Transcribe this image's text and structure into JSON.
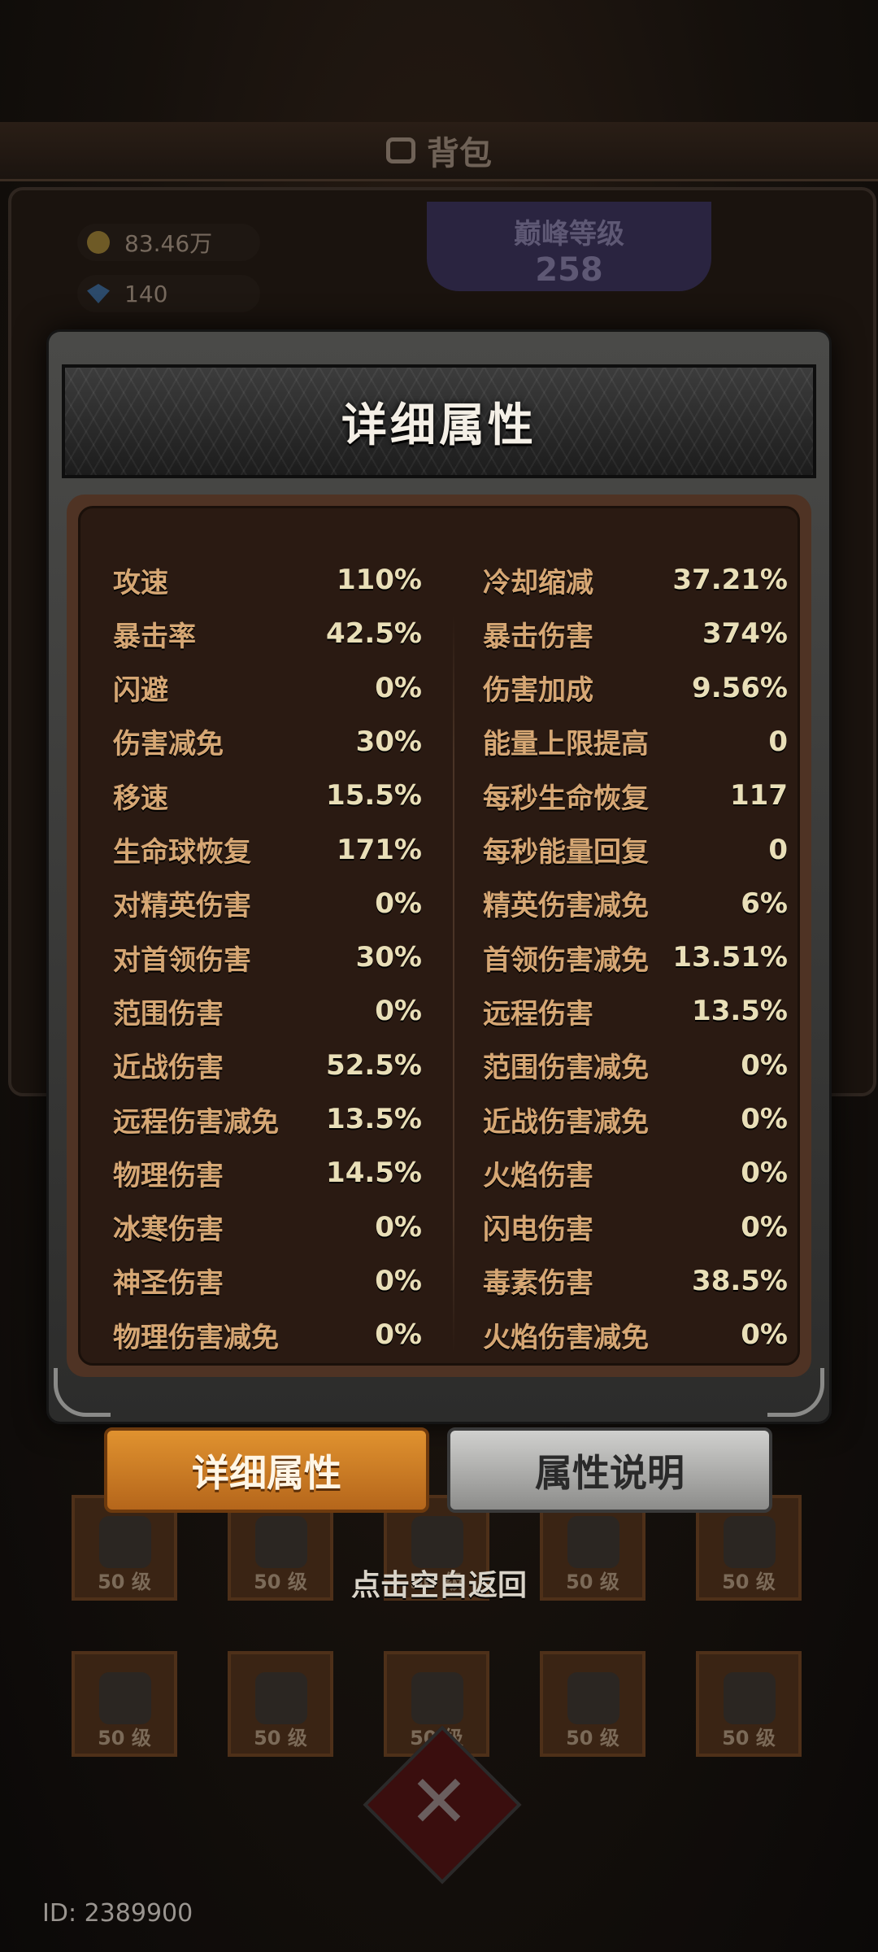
{
  "background": {
    "title": "背包",
    "currency_gold": "83.46万",
    "currency_gem": "140",
    "peak_label": "巅峰等级",
    "peak_value": "258",
    "slots_row1": [
      {
        "icon": "clover-icon",
        "level": "50 级"
      },
      {
        "icon": "armor-icon",
        "level": "50 级"
      },
      {
        "icon": "helmet-icon",
        "level": "50 级"
      },
      {
        "icon": "cloak-icon",
        "level": "50 级"
      },
      {
        "icon": "hat-icon",
        "level": "50 级"
      }
    ],
    "slots_row2": [
      {
        "icon": "boots-icon",
        "level": "50 级"
      },
      {
        "icon": "boots-icon",
        "level": "50 级"
      },
      {
        "icon": "helm-icon",
        "level": "50 级"
      },
      {
        "icon": "necklace-icon",
        "level": "50 级"
      },
      {
        "icon": "crab-icon",
        "level": "50 级"
      }
    ],
    "player_id": "ID: 2389900"
  },
  "modal": {
    "title": "详细属性",
    "left_stats": [
      {
        "name": "攻速",
        "value": "110%"
      },
      {
        "name": "暴击率",
        "value": "42.5%"
      },
      {
        "name": "闪避",
        "value": "0%"
      },
      {
        "name": "伤害减免",
        "value": "30%"
      },
      {
        "name": "移速",
        "value": "15.5%"
      },
      {
        "name": "生命球恢复",
        "value": "171%"
      },
      {
        "name": "对精英伤害",
        "value": "0%"
      },
      {
        "name": "对首领伤害",
        "value": "30%"
      },
      {
        "name": "范围伤害",
        "value": "0%"
      },
      {
        "name": "近战伤害",
        "value": "52.5%"
      },
      {
        "name": "远程伤害减免",
        "value": "13.5%"
      },
      {
        "name": "物理伤害",
        "value": "14.5%"
      },
      {
        "name": "冰寒伤害",
        "value": "0%"
      },
      {
        "name": "神圣伤害",
        "value": "0%"
      },
      {
        "name": "物理伤害减免",
        "value": "0%"
      }
    ],
    "right_stats": [
      {
        "name": "冷却缩减",
        "value": "37.21%"
      },
      {
        "name": "暴击伤害",
        "value": "374%"
      },
      {
        "name": "伤害加成",
        "value": "9.56%"
      },
      {
        "name": "能量上限提高",
        "value": "0"
      },
      {
        "name": "每秒生命恢复",
        "value": "117"
      },
      {
        "name": "每秒能量回复",
        "value": "0"
      },
      {
        "name": "精英伤害减免",
        "value": "6%"
      },
      {
        "name": "首领伤害减免",
        "value": "13.51%"
      },
      {
        "name": "远程伤害",
        "value": "13.5%"
      },
      {
        "name": "范围伤害减免",
        "value": "0%"
      },
      {
        "name": "近战伤害减免",
        "value": "0%"
      },
      {
        "name": "火焰伤害",
        "value": "0%"
      },
      {
        "name": "闪电伤害",
        "value": "0%"
      },
      {
        "name": "毒素伤害",
        "value": "38.5%"
      },
      {
        "name": "火焰伤害减免",
        "value": "0%"
      }
    ]
  },
  "tabs": {
    "detail_label": "详细属性",
    "explain_label": "属性说明"
  },
  "hint": {
    "return_text": "点击空白返回"
  },
  "colors": {
    "stat_name": "#d6a774",
    "stat_value": "#e9dfb8",
    "tab_active": "#e0922f"
  }
}
